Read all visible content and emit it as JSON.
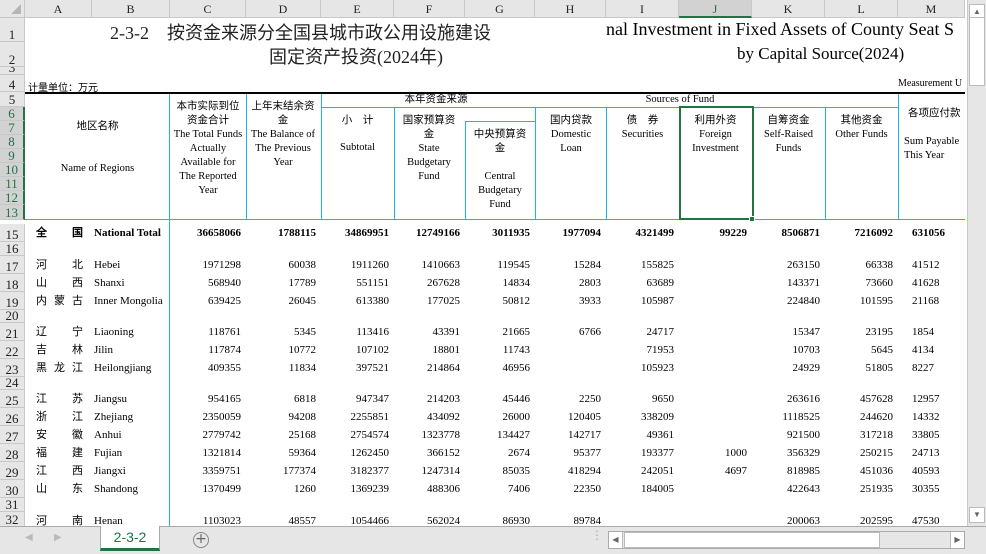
{
  "columns": [
    "A",
    "B",
    "C",
    "D",
    "E",
    "F",
    "G",
    "H",
    "I",
    "J",
    "K",
    "L",
    "M"
  ],
  "row_numbers": [
    "1",
    "2",
    "3",
    "4",
    "5",
    "6",
    "7",
    "8",
    "9",
    "10",
    "11",
    "12",
    "13",
    "15",
    "16",
    "17",
    "18",
    "19",
    "20",
    "21",
    "22",
    "23",
    "24",
    "25",
    "26",
    "27",
    "28",
    "29",
    "30",
    "31",
    "32"
  ],
  "title": {
    "zh_line1": "2-3-2　按资金来源分全国县城市政公用设施建设",
    "zh_line2": "固定资产投资(2024年)",
    "en_line1": "nal Investment in Fixed Assets of County Seat S",
    "en_line2": "by Capital Source(2024)"
  },
  "unit_zh": "计量单位：万元",
  "unit_en": "Measurement U",
  "headers": {
    "region_zh": "地区名称",
    "region_en": "Name of Regions",
    "total_zh": "本市实际到位资金合计",
    "total_en": "The Total Funds Actually Available for The Reported Year",
    "balance_zh": "上年末结余资金",
    "balance_en": "The Balance of The Previous Year",
    "sources_zh": "本年资金来源",
    "sources_en": "Sources of Fund",
    "subtotal_zh": "小　计",
    "subtotal_en": "Subtotal",
    "state_zh": "国家预算资　金",
    "state_en": "State Budgetary Fund",
    "central_zh": "中央预算资　　金",
    "central_en": "Central Budgetary Fund",
    "domestic_zh": "国内贷款",
    "domestic_en": "Domestic Loan",
    "securities_zh": "债　券",
    "securities_en": "Securities",
    "foreign_zh": "利用外资",
    "foreign_en": "Foreign Investment",
    "selfraised_zh": "自筹资金",
    "selfraised_en": "Self-Raised Funds",
    "other_zh": "其他资金",
    "other_en": "Other Funds",
    "payable_zh": "各项应付款",
    "payable_en": "Sum Payable This Year"
  },
  "rows": [
    {
      "row": "15",
      "zh": "全 国",
      "en": "National Total",
      "bold": true,
      "values": [
        "36658066",
        "1788115",
        "34869951",
        "12749166",
        "3011935",
        "1977094",
        "4321499",
        "99229",
        "8506871",
        "7216092",
        "631056"
      ]
    },
    {
      "row": "16",
      "blank": true
    },
    {
      "row": "17",
      "zh": "河 北",
      "en": "Hebei",
      "values": [
        "1971298",
        "60038",
        "1911260",
        "1410663",
        "119545",
        "15284",
        "155825",
        "",
        "263150",
        "66338",
        "41512"
      ]
    },
    {
      "row": "18",
      "zh": "山 西",
      "en": "Shanxi",
      "values": [
        "568940",
        "17789",
        "551151",
        "267628",
        "14834",
        "2803",
        "63689",
        "",
        "143371",
        "73660",
        "41628"
      ]
    },
    {
      "row": "19",
      "zh": "内 蒙 古",
      "en": "Inner Mongolia",
      "values": [
        "639425",
        "26045",
        "613380",
        "177025",
        "50812",
        "3933",
        "105987",
        "",
        "224840",
        "101595",
        "21168"
      ]
    },
    {
      "row": "20",
      "blank": true
    },
    {
      "row": "21",
      "zh": "辽 宁",
      "en": "Liaoning",
      "values": [
        "118761",
        "5345",
        "113416",
        "43391",
        "21665",
        "6766",
        "24717",
        "",
        "15347",
        "23195",
        "1854"
      ]
    },
    {
      "row": "22",
      "zh": "吉 林",
      "en": "Jilin",
      "values": [
        "117874",
        "10772",
        "107102",
        "18801",
        "11743",
        "",
        "71953",
        "",
        "10703",
        "5645",
        "4134"
      ]
    },
    {
      "row": "23",
      "zh": "黑 龙 江",
      "en": "Heilongjiang",
      "values": [
        "409355",
        "11834",
        "397521",
        "214864",
        "46956",
        "",
        "105923",
        "",
        "24929",
        "51805",
        "8227"
      ]
    },
    {
      "row": "24",
      "blank": true
    },
    {
      "row": "25",
      "zh": "江 苏",
      "en": "Jiangsu",
      "values": [
        "954165",
        "6818",
        "947347",
        "214203",
        "45446",
        "2250",
        "9650",
        "",
        "263616",
        "457628",
        "12957"
      ]
    },
    {
      "row": "26",
      "zh": "浙 江",
      "en": "Zhejiang",
      "values": [
        "2350059",
        "94208",
        "2255851",
        "434092",
        "26000",
        "120405",
        "338209",
        "",
        "1118525",
        "244620",
        "14332"
      ]
    },
    {
      "row": "27",
      "zh": "安 徽",
      "en": "Anhui",
      "values": [
        "2779742",
        "25168",
        "2754574",
        "1323778",
        "134427",
        "142717",
        "49361",
        "",
        "921500",
        "317218",
        "33805"
      ]
    },
    {
      "row": "28",
      "zh": "福 建",
      "en": "Fujian",
      "values": [
        "1321814",
        "59364",
        "1262450",
        "366152",
        "2674",
        "95377",
        "193377",
        "1000",
        "356329",
        "250215",
        "24713"
      ]
    },
    {
      "row": "29",
      "zh": "江 西",
      "en": "Jiangxi",
      "values": [
        "3359751",
        "177374",
        "3182377",
        "1247314",
        "85035",
        "418294",
        "242051",
        "4697",
        "818985",
        "451036",
        "40593"
      ]
    },
    {
      "row": "30",
      "zh": "山 东",
      "en": "Shandong",
      "values": [
        "1370499",
        "1260",
        "1369239",
        "488306",
        "7406",
        "22350",
        "184005",
        "",
        "422643",
        "251935",
        "30355"
      ]
    },
    {
      "row": "31",
      "blank": true
    },
    {
      "row": "32",
      "zh": "河 南",
      "en": "Henan",
      "values": [
        "1103023",
        "48557",
        "1054466",
        "562024",
        "86930",
        "89784",
        "",
        "",
        "200063",
        "202595",
        "47530"
      ]
    }
  ],
  "sheet_tab": "2-3-2",
  "colors": {
    "accent": "#217346",
    "border": "#1ab5e6"
  }
}
